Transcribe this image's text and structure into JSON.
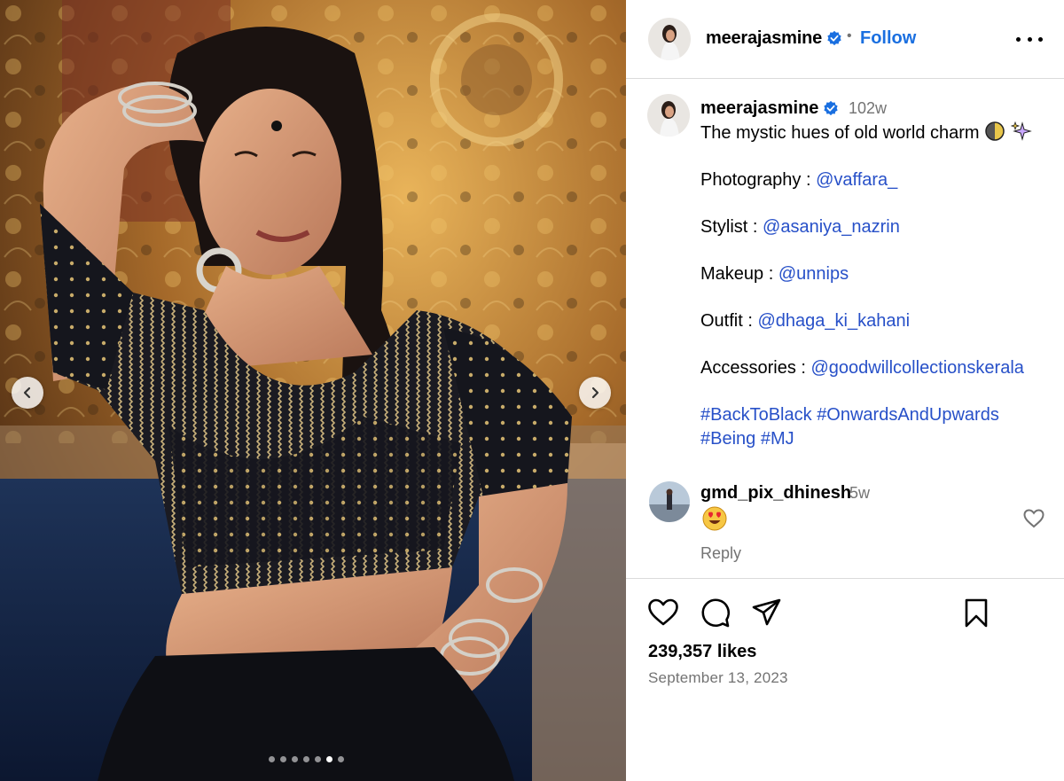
{
  "post": {
    "username": "meerajasmine",
    "follow_label": "Follow",
    "separator": "•"
  },
  "caption": {
    "username": "meerajasmine",
    "time": "102w",
    "line1": "The mystic hues of old world charm",
    "credits": [
      {
        "label": "Photography : ",
        "handle": "@vaffara_"
      },
      {
        "label": "Stylist : ",
        "handle": "@asaniya_nazrin"
      },
      {
        "label": "Makeup : ",
        "handle": "@unnips"
      },
      {
        "label": "Outfit : ",
        "handle": "@dhaga_ki_kahani"
      },
      {
        "label": "Accessories : ",
        "handle": "@goodwillcollectionskerala"
      }
    ],
    "hashtags": [
      "#BackToBlack",
      "#OnwardsAndUpwards",
      "#Being",
      "#MJ"
    ]
  },
  "comment": {
    "username": "gmd_pix_dhinesh",
    "time": "5w",
    "emoji_icon": "heart-eyes-emoji",
    "reply_label": "Reply"
  },
  "stats": {
    "likes": "239,357 likes",
    "date": "September 13, 2023"
  },
  "carousel": {
    "total": 7,
    "active_index": 5
  },
  "colors": {
    "link": "#2750c8",
    "follow": "#1a6fe0",
    "muted": "#737373",
    "verified": "#1a6fe0"
  },
  "icons": [
    "more-options-icon",
    "verified-badge-icon",
    "chevron-left-icon",
    "chevron-right-icon",
    "heart-icon",
    "comment-icon",
    "share-icon",
    "bookmark-icon"
  ]
}
